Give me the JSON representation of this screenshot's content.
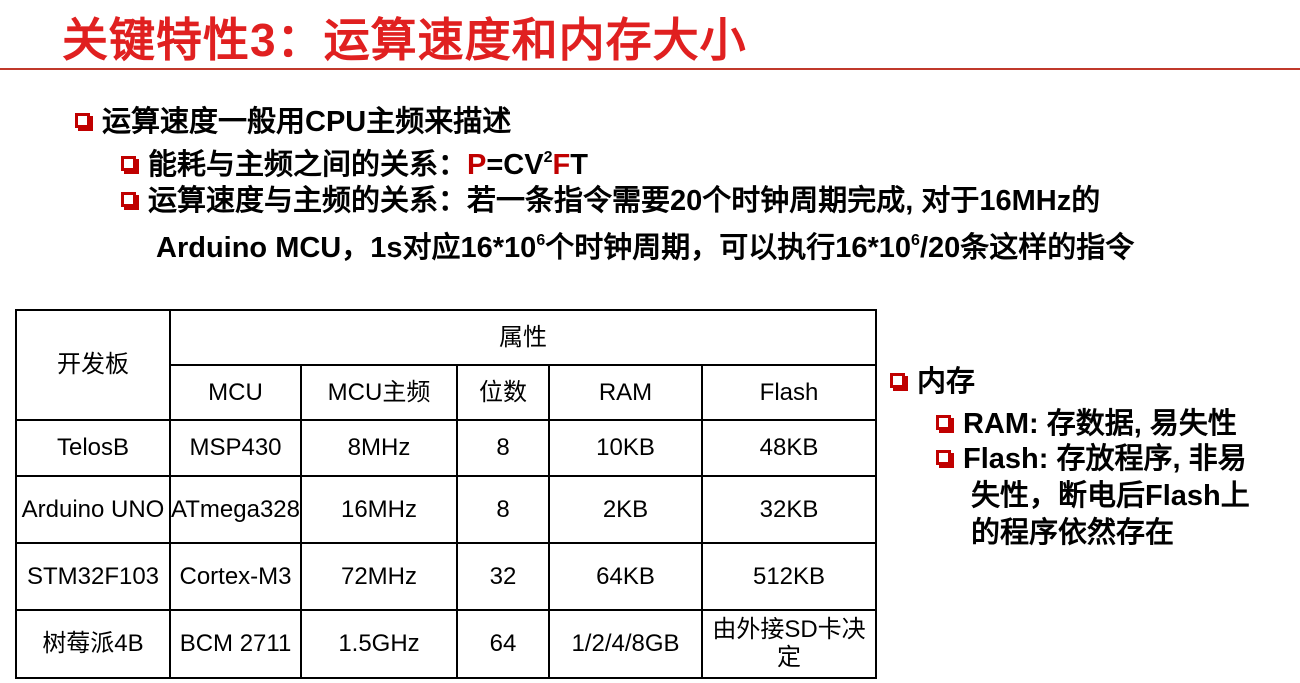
{
  "slide": {
    "title": "关键特性3：运算速度和内存大小"
  },
  "bullets": {
    "speed": "运算速度一般用CPU主频来描述",
    "power_prefix": "能耗与主频之间的关系：",
    "power_p": "P",
    "power_eq": "=CV",
    "power_exp": "2",
    "power_f": "F",
    "power_t": "T",
    "relation_line1": "运算速度与主频的关系：若一条指令需要20个时钟周期完成, 对于16MHz的",
    "relation_line2_a": "Arduino MCU，1s对应16*10",
    "relation_exp1": "6",
    "relation_line2_b": "个时钟周期，可以执行16*10",
    "relation_exp2": "6",
    "relation_line2_c": "/20条这样的指令"
  },
  "table": {
    "board_header": "开发板",
    "attr_header": "属性",
    "columns": [
      "MCU",
      "MCU主频",
      "位数",
      "RAM",
      "Flash"
    ],
    "rows": [
      {
        "board": "TelosB",
        "mcu": "MSP430",
        "freq": "8MHz",
        "bits": "8",
        "ram": "10KB",
        "flash": "48KB"
      },
      {
        "board": "Arduino UNO",
        "mcu": "ATmega328",
        "freq": "16MHz",
        "bits": "8",
        "ram": "2KB",
        "flash": "32KB"
      },
      {
        "board": "STM32F103",
        "mcu": "Cortex-M3",
        "freq": "72MHz",
        "bits": "32",
        "ram": "64KB",
        "flash": "512KB"
      },
      {
        "board": "树莓派4B",
        "mcu": "BCM 2711",
        "freq": "1.5GHz",
        "bits": "64",
        "ram": "1/2/4/8GB",
        "flash": "由外接SD卡决定"
      }
    ]
  },
  "memory": {
    "heading": "内存",
    "ram": "RAM: 存数据, 易失性",
    "flash_line1": "Flash: 存放程序, 非易",
    "flash_line2": "失性，断电后Flash上",
    "flash_line3": "的程序依然存在"
  }
}
